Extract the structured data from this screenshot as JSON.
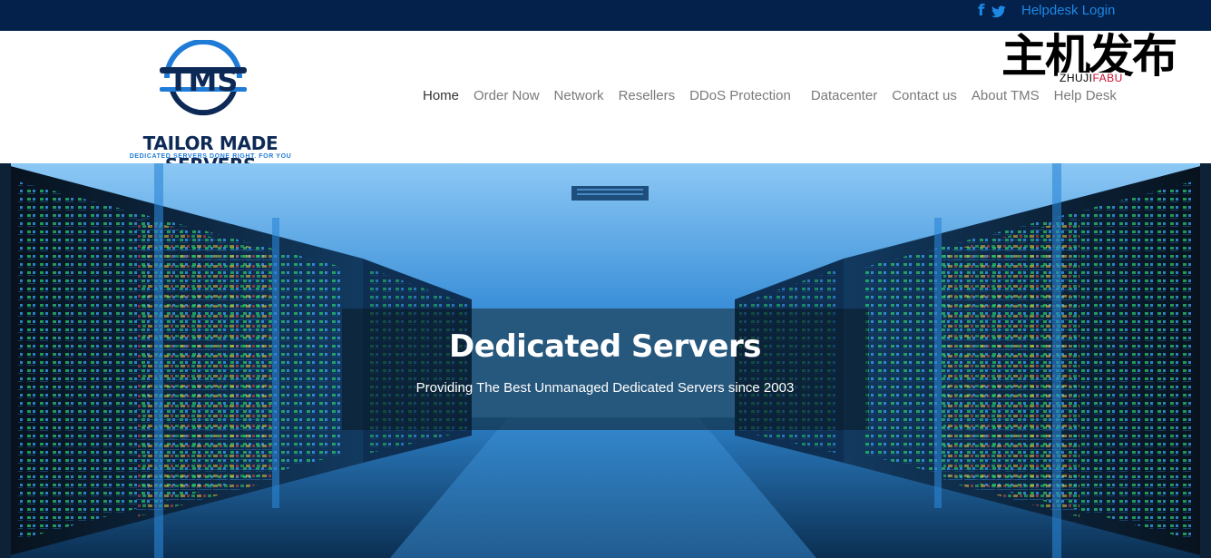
{
  "topbar": {
    "social_icons": [
      "facebook-icon",
      "twitter-icon"
    ],
    "facebook_glyph": "f",
    "login_label": "Helpdesk Login"
  },
  "header": {
    "logo": {
      "monogram": "TMS",
      "brand": "TAILOR MADE SERVERS",
      "tagline": "DEDICATED SERVERS DONE RIGHT. FOR YOU"
    },
    "nav": {
      "items": [
        {
          "label": "Home",
          "active": true
        },
        {
          "label": "Order Now",
          "active": false
        },
        {
          "label": "Network",
          "active": false
        },
        {
          "label": "Resellers",
          "active": false
        },
        {
          "label": "DDoS Protection",
          "active": false
        },
        {
          "label": "Datacenter",
          "active": false
        },
        {
          "label": "Contact us",
          "active": false
        },
        {
          "label": "About TMS",
          "active": false
        },
        {
          "label": "Help Desk",
          "active": false
        }
      ]
    },
    "watermark": {
      "chinese": "主机发布",
      "pinyin_a": "ZHUJI",
      "pinyin_b": "FABU"
    }
  },
  "hero": {
    "title": "Dedicated Servers",
    "subtitle": "Providing The Best Unmanaged Dedicated Servers since 2003",
    "image": "server-room-corridor"
  },
  "colors": {
    "topbar_bg": "#03214a",
    "link_blue": "#1e88e5",
    "brand_navy": "#0d2a57",
    "nav_text": "#7a7a7a",
    "nav_active": "#333333"
  }
}
